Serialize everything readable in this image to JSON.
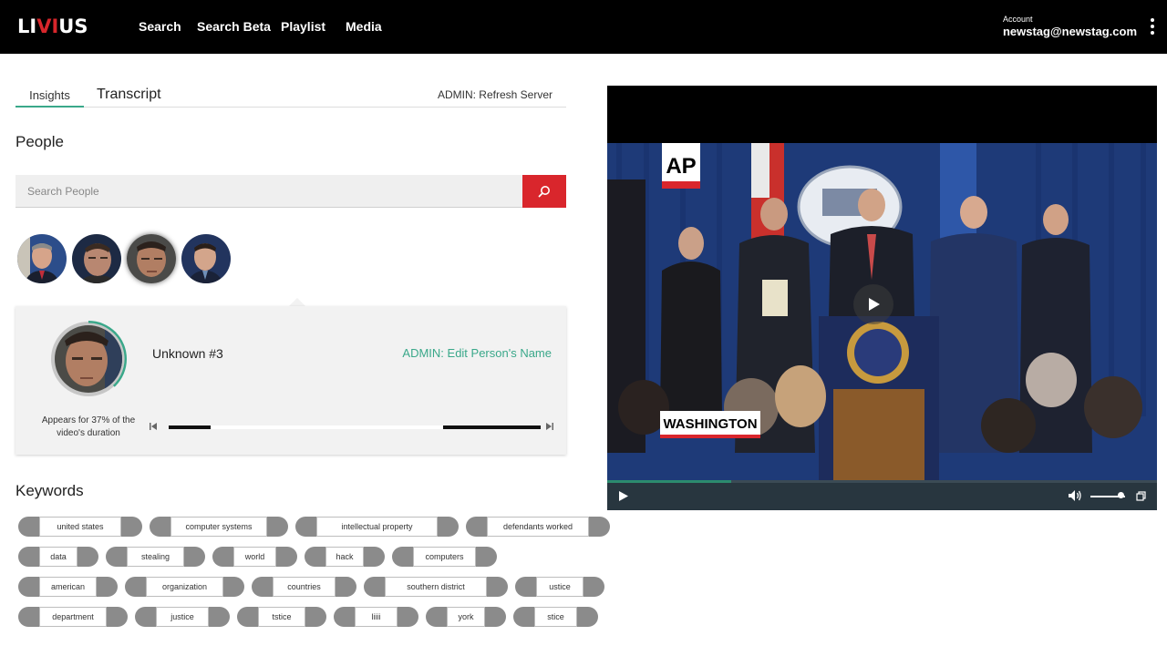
{
  "brand": {
    "logo_part1": "LI",
    "logo_red": "VI",
    "logo_part2": "US",
    "brand_color": "#d9262c",
    "accent_color": "#3aa88a"
  },
  "nav": {
    "items": [
      "Search",
      "Search Beta",
      "Playlist",
      "Media"
    ]
  },
  "account": {
    "label": "Account",
    "email": "newstag@newstag.com",
    "menu_icon": "kebab-menu-icon"
  },
  "tabs": {
    "insights": "Insights",
    "transcript": "Transcript",
    "admin_refresh": "ADMIN: Refresh Server",
    "active": "Insights"
  },
  "people": {
    "title": "People",
    "search_placeholder": "Search People",
    "search_icon": "search-icon",
    "selected_index": 2,
    "avatar_count": 4
  },
  "person": {
    "name": "Unknown #3",
    "edit_label": "ADMIN: Edit Person's Name",
    "appears_text": "Appears for 37% of the video's duration",
    "appearance_fraction": 0.37,
    "segments": [
      {
        "start": 0.0,
        "end": 0.113
      },
      {
        "start": 0.738,
        "end": 1.0
      }
    ]
  },
  "keywords": {
    "title": "Keywords",
    "rows": [
      [
        "united states",
        "computer systems",
        "intellectual property",
        "defendants worked"
      ],
      [
        "data",
        "stealing",
        "world",
        "hack",
        "computers"
      ],
      [
        "american",
        "organization",
        "countries",
        "southern district",
        "ustice"
      ],
      [
        "department",
        "justice",
        "tstice",
        "liiii",
        "york",
        "stice"
      ]
    ]
  },
  "video": {
    "watermark": "AP",
    "caption": "WASHINGTON",
    "progress_fraction": 0.225,
    "volume_fraction": 0.9,
    "icons": [
      "play-icon",
      "volume-icon",
      "fullscreen-icon"
    ]
  }
}
